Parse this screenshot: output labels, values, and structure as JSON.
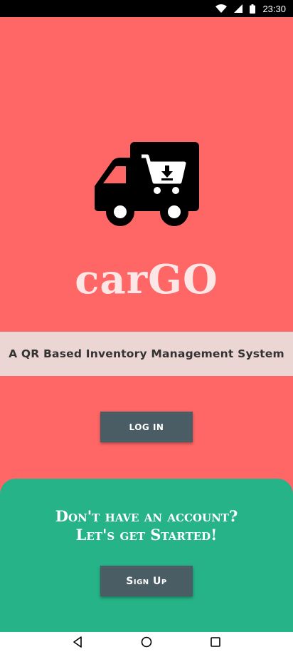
{
  "status_bar": {
    "time": "23:30",
    "icons": [
      "wifi-icon",
      "signal-icon",
      "battery-icon"
    ]
  },
  "app": {
    "name": "carGO",
    "tagline": "A QR Based Inventory Management System",
    "logo_icon": "delivery-truck-cart-icon"
  },
  "login": {
    "label": "LOG IN"
  },
  "signup": {
    "title_line1": "Don't have an account?",
    "title_line2": "Let's get Started!",
    "label": "Sign Up"
  },
  "nav": {
    "icons": [
      "back-icon",
      "home-icon",
      "recents-icon"
    ]
  },
  "colors": {
    "background": "#ff6766",
    "tagline_band": "#ecd6d4",
    "button": "#4a5d65",
    "signup_panel": "#26b387",
    "app_name": "#fde7e6"
  }
}
